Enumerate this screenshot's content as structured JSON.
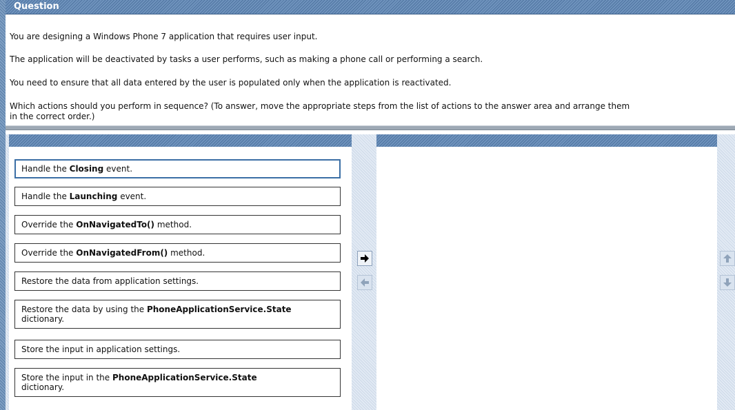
{
  "question": {
    "header": "Question",
    "lines": [
      "You are designing a Windows Phone 7 application that requires user input.",
      "The application will be deactivated by tasks a user performs, such as making a phone call or performing a search.",
      "You need to ensure that all data entered by the user is populated only when the application is reactivated.",
      "Which actions should you perform in sequence? (To answer, move the appropriate steps from the list of actions to the answer area and arrange them",
      "in the correct order.)"
    ]
  },
  "actions": [
    {
      "pre": "Handle the ",
      "bold": "Closing",
      "post": " event.",
      "line2": ""
    },
    {
      "pre": "Handle the ",
      "bold": "Launching",
      "post": " event.",
      "line2": ""
    },
    {
      "pre": "Override the ",
      "bold": "OnNavigatedTo()",
      "post": " method.",
      "line2": ""
    },
    {
      "pre": "Override the ",
      "bold": "OnNavigatedFrom()",
      "post": " method.",
      "line2": ""
    },
    {
      "pre": "Restore the data from application settings.",
      "bold": "",
      "post": "",
      "line2": ""
    },
    {
      "pre": "Restore the data by using the ",
      "bold": "PhoneApplicationService.State",
      "post": "",
      "line2": "dictionary."
    },
    {
      "pre": "Store the input in application settings.",
      "bold": "",
      "post": "",
      "line2": ""
    },
    {
      "pre": "Store the input in the ",
      "bold": "PhoneApplicationService.State",
      "post": "",
      "line2": "dictionary."
    }
  ],
  "icons": {
    "move_right": "arrow-right-icon",
    "move_left": "arrow-left-icon",
    "move_up": "arrow-up-icon",
    "move_down": "arrow-down-icon"
  }
}
